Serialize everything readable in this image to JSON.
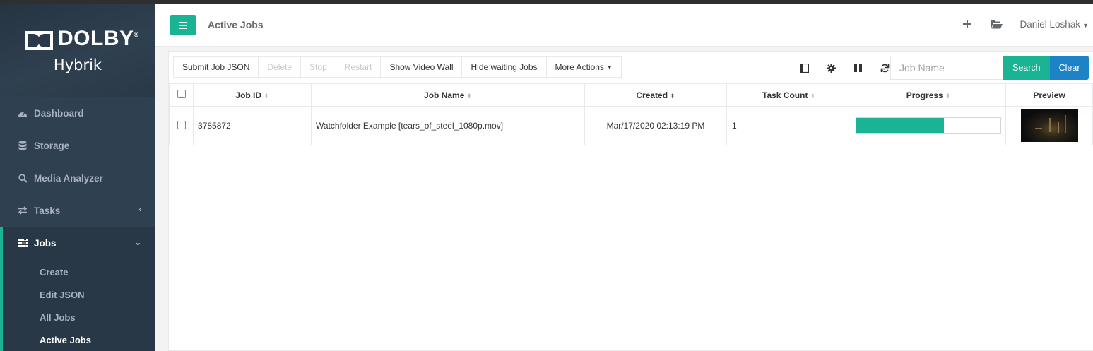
{
  "brand": {
    "logo_text": "DOLBY",
    "trademark": "®",
    "product": "Hybrik"
  },
  "sidebar": {
    "items": [
      {
        "label": "Dashboard",
        "icon": "dashboard-icon"
      },
      {
        "label": "Storage",
        "icon": "database-icon"
      },
      {
        "label": "Media Analyzer",
        "icon": "search-icon"
      },
      {
        "label": "Tasks",
        "icon": "exchange-icon"
      },
      {
        "label": "Jobs",
        "icon": "tasks-icon"
      }
    ],
    "jobs_submenu": [
      "Create",
      "Edit JSON",
      "All Jobs",
      "Active Jobs"
    ]
  },
  "header": {
    "title": "Active Jobs",
    "user": "Daniel Loshak"
  },
  "toolbar": {
    "buttons": [
      "Submit Job JSON",
      "Delete",
      "Stop",
      "Restart",
      "Show Video Wall",
      "Hide waiting Jobs",
      "More Actions"
    ]
  },
  "search": {
    "placeholder": "Job Name",
    "search_label": "Search",
    "clear_label": "Clear"
  },
  "table": {
    "columns": [
      "Job ID",
      "Job Name",
      "Created",
      "Task Count",
      "Progress",
      "Preview"
    ],
    "rows": [
      {
        "job_id": "3785872",
        "job_name": "Watchfolder Example [tears_of_steel_1080p.mov]",
        "created": "Mar/17/2020 02:13:19 PM",
        "task_count": "1",
        "progress": 0.61
      }
    ]
  },
  "colors": {
    "accent": "#1ab394",
    "sidebar": "#2f4050",
    "clear_button": "#1c84c6"
  }
}
